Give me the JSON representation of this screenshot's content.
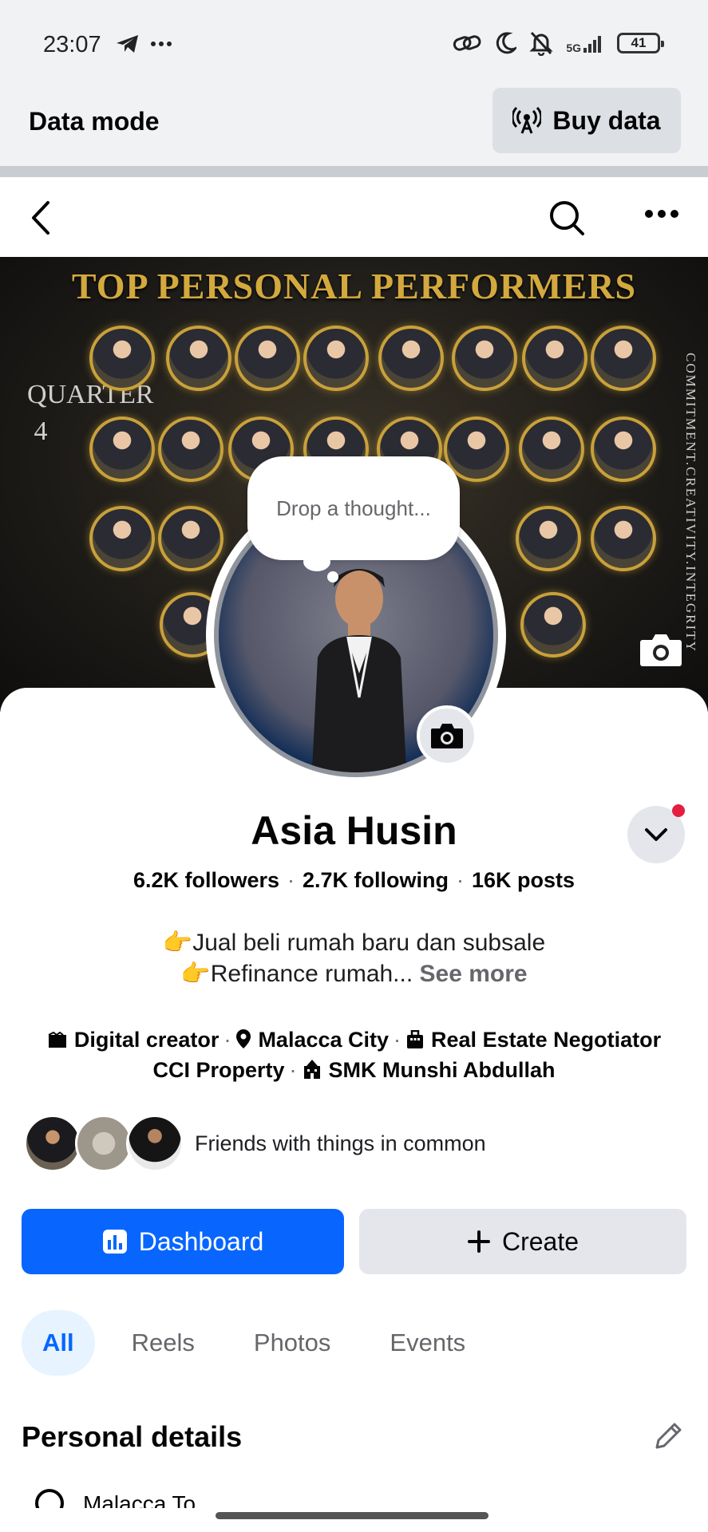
{
  "status_bar": {
    "time": "23:07",
    "left_icons": [
      "telegram-icon",
      "more-dots-icon"
    ],
    "right_icons": [
      "link-icon",
      "moon-icon",
      "bell-off-icon",
      "signal-5g-icon"
    ],
    "network": "5G",
    "battery": "41"
  },
  "data_bar": {
    "label": "Data mode",
    "buy_label": "Buy data"
  },
  "nav": {
    "icons": [
      "back-icon",
      "search-icon",
      "more-icon"
    ]
  },
  "cover": {
    "title": "TOP PERSONAL PERFORMERS",
    "side_left": "QUARTER 4",
    "side_right": "COMMITMENT.CREATIVITY.INTEGRITY"
  },
  "thought": {
    "placeholder": "Drop a thought..."
  },
  "profile": {
    "name": "Asia Husin",
    "followers": "6.2K followers",
    "following": "2.7K following",
    "posts": "16K posts",
    "bio_line1": "👉Jual beli rumah baru dan subsale",
    "bio_line2": "👉Refinance rumah...",
    "see_more": "See more",
    "meta": {
      "creator": "Digital creator",
      "city": "Malacca City",
      "job": "Real Estate Negotiator",
      "company": "CCI Property",
      "school": "SMK Munshi Abdullah"
    },
    "friends_label": "Friends with things in common"
  },
  "actions": {
    "dashboard": "Dashboard",
    "create": "Create"
  },
  "tabs": [
    {
      "label": "All",
      "active": true
    },
    {
      "label": "Reels",
      "active": false
    },
    {
      "label": "Photos",
      "active": false
    },
    {
      "label": "Events",
      "active": false
    }
  ],
  "section": {
    "title": "Personal details",
    "first_item": "Malacca To..."
  },
  "colors": {
    "accent": "#0866ff",
    "accent_light": "#e7f3ff",
    "secondary_button": "#e4e6eb",
    "muted_text": "#65676b",
    "notification_dot": "#e41e3f",
    "cover_gold": "#d3a93e"
  }
}
